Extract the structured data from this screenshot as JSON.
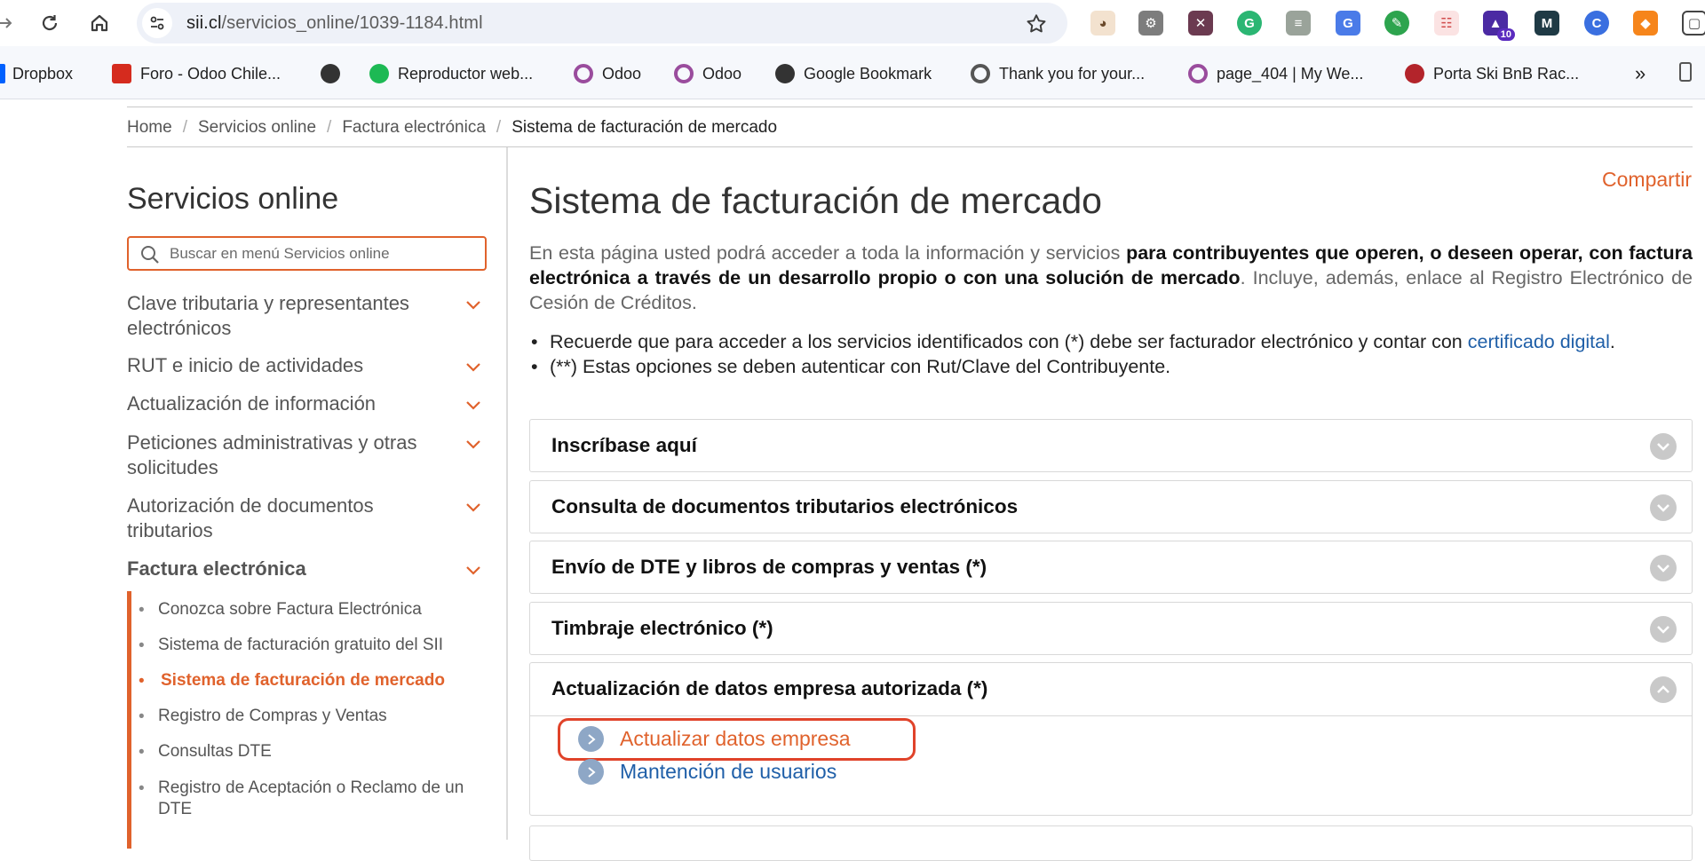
{
  "browser": {
    "url_domain": "sii.cl",
    "url_path": "/servicios_online/1039-1184.html",
    "extension_badge": "10",
    "bookmarks": [
      {
        "label": "Dropbox"
      },
      {
        "label": "Foro - Odoo Chile..."
      },
      {
        "label": ""
      },
      {
        "label": "Reproductor web..."
      },
      {
        "label": "Odoo"
      },
      {
        "label": "Odoo"
      },
      {
        "label": "Google Bookmark"
      },
      {
        "label": "Thank you for your..."
      },
      {
        "label": "page_404 | My We..."
      },
      {
        "label": "Porta Ski BnB Rac..."
      }
    ],
    "overflow": "»"
  },
  "breadcrumb": {
    "items": [
      "Home",
      "Servicios online",
      "Factura electrónica"
    ],
    "current": "Sistema de facturación de mercado",
    "separator": "/"
  },
  "sidebar": {
    "title": "Servicios online",
    "search_placeholder": "Buscar en menú Servicios online",
    "items": [
      {
        "label": "Clave tributaria y representantes electrónicos"
      },
      {
        "label": "RUT e inicio de actividades"
      },
      {
        "label": "Actualización de información"
      },
      {
        "label": "Peticiones administrativas y otras solicitudes"
      },
      {
        "label": "Autorización de documentos tributarios"
      },
      {
        "label": "Factura electrónica"
      }
    ],
    "subitems": [
      {
        "label": "Conozca sobre Factura Electrónica"
      },
      {
        "label": "Sistema de facturación gratuito del SII"
      },
      {
        "label": "Sistema de facturación de mercado"
      },
      {
        "label": "Registro de Compras y Ventas"
      },
      {
        "label": "Consultas DTE"
      },
      {
        "label": "Registro de Aceptación o Reclamo de un DTE"
      }
    ]
  },
  "main": {
    "share": "Compartir",
    "title": "Sistema de facturación de mercado",
    "intro_start": "En esta página usted podrá acceder a toda la información y servicios ",
    "intro_bold": "para contribuyentes que operen, o deseen operar, con factura electrónica a través de un desarrollo propio o con una solución de mercado",
    "intro_end": ". Incluye, además, enlace al Registro Electrónico de Cesión de Créditos.",
    "note1_text": "Recuerde que para acceder a los servicios identificados con (*) debe ser facturador electrónico y contar con ",
    "note1_link": "certificado digital",
    "note1_end": ".",
    "note2": "(**) Estas opciones se deben autenticar con Rut/Clave del Contribuyente.",
    "accordion": [
      {
        "label": "Inscríbase aquí"
      },
      {
        "label": "Consulta de documentos tributarios electrónicos"
      },
      {
        "label": "Envío de DTE y libros de compras y ventas (*)"
      },
      {
        "label": "Timbraje electrónico (*)"
      }
    ],
    "open_section": {
      "label": "Actualización de datos empresa autorizada (*)",
      "links": [
        {
          "label": "Actualizar datos empresa",
          "color": "#e0622c"
        },
        {
          "label": "Mantención de usuarios",
          "color": "#1f5fa8"
        }
      ]
    }
  },
  "colors": {
    "accent": "#e0622c",
    "link": "#1f5fa8",
    "highlight": "#e0432a"
  }
}
